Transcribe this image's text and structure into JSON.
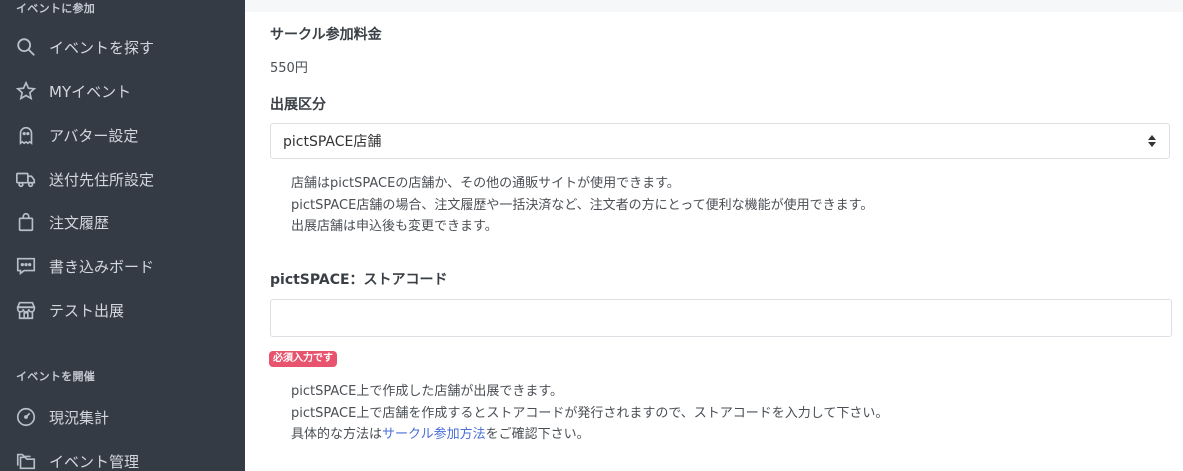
{
  "sidebar": {
    "section_join": "イベントに参加",
    "section_host": "イベントを開催",
    "items": [
      {
        "label": "イベントを探す",
        "icon": "search-icon"
      },
      {
        "label": "MYイベント",
        "icon": "star-icon"
      },
      {
        "label": "アバター設定",
        "icon": "ghost-icon"
      },
      {
        "label": "送付先住所設定",
        "icon": "truck-icon"
      },
      {
        "label": "注文履歴",
        "icon": "shopping-bag-icon"
      },
      {
        "label": "書き込みボード",
        "icon": "chat-icon"
      },
      {
        "label": "テスト出展",
        "icon": "store-icon"
      },
      {
        "label": "現況集計",
        "icon": "gauge-icon"
      },
      {
        "label": "イベント管理",
        "icon": "folders-icon"
      }
    ]
  },
  "form": {
    "fee_heading": "サークル参加料金",
    "fee_value": "550円",
    "category_heading": "出展区分",
    "category_selected": "pictSPACE店舗",
    "category_help": [
      "店舗はpictSPACEの店舗か、その他の通販サイトが使用できます。",
      "pictSPACE店舗の場合、注文履歴や一括決済など、注文者の方にとって便利な機能が使用できます。",
      "出展店舗は申込後も変更できます。"
    ],
    "store_code_heading": "pictSPACE：ストアコード",
    "store_code_value": "",
    "required_badge": "必須入力です",
    "store_help": [
      "pictSPACE上で作成した店舗が出展できます。",
      "pictSPACE上で店舗を作成するとストアコードが発行されますので、ストアコードを入力して下さい。"
    ],
    "store_help_last_prefix": "具体的な方法は",
    "store_help_link": "サークル参加方法",
    "store_help_last_suffix": "をご確認下さい。"
  },
  "colors": {
    "sidebar_bg": "#343b45",
    "badge_bg": "#e8536e",
    "link": "#4a6fd8"
  }
}
